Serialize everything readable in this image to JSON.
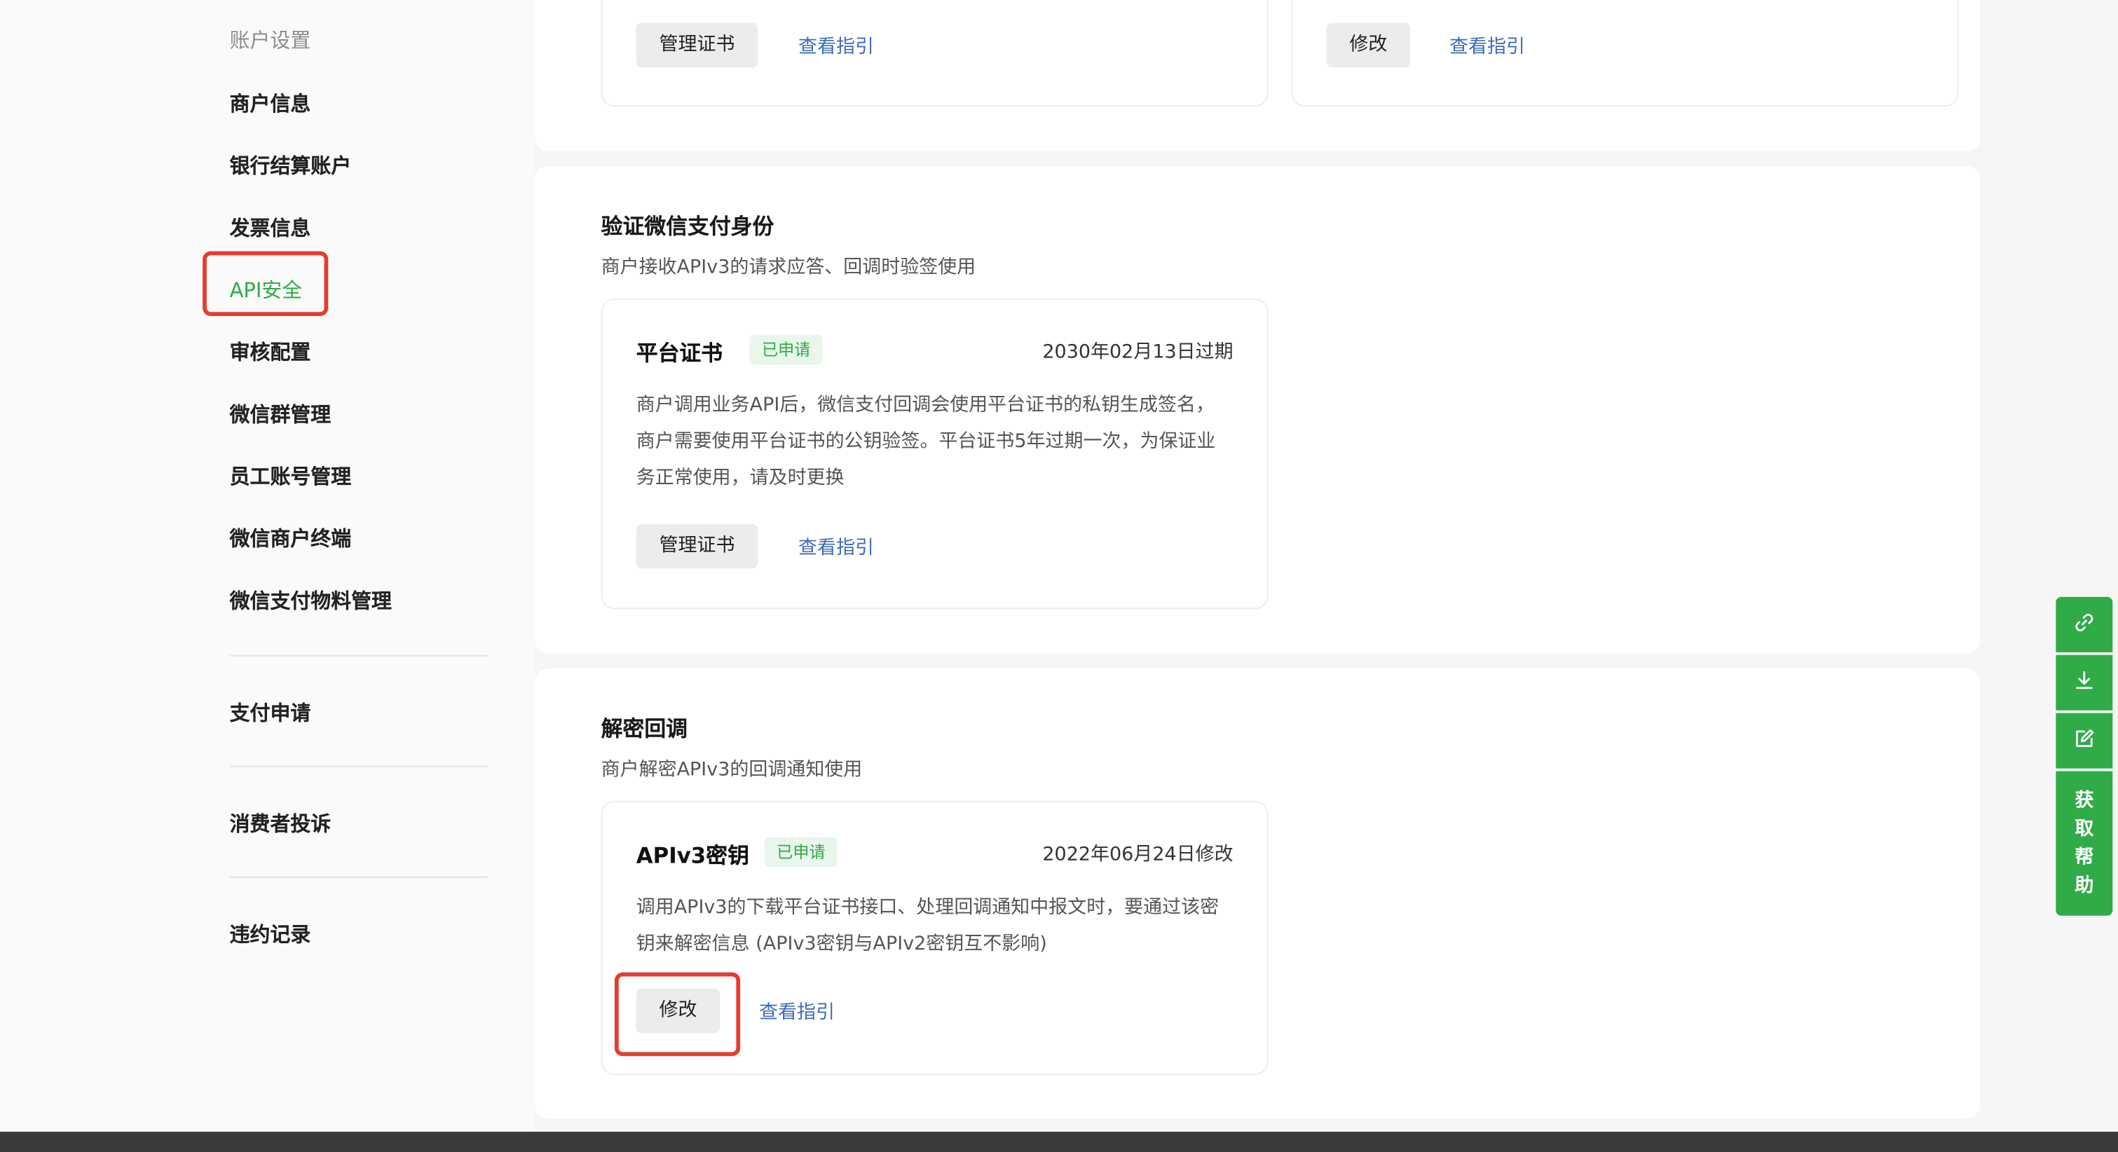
{
  "sidebar": {
    "group_title": "账户设置",
    "items": [
      {
        "label": "商户信息"
      },
      {
        "label": "银行结算账户"
      },
      {
        "label": "发票信息"
      },
      {
        "label": "API安全"
      },
      {
        "label": "审核配置"
      },
      {
        "label": "微信群管理"
      },
      {
        "label": "员工账号管理"
      },
      {
        "label": "微信商户终端"
      },
      {
        "label": "微信支付物料管理"
      }
    ],
    "active_item": "API安全",
    "sections": [
      {
        "label": "支付申请"
      },
      {
        "label": "消费者投诉"
      },
      {
        "label": "违约记录"
      }
    ]
  },
  "top_panel": {
    "left_card": {
      "button": "管理证书",
      "link": "查看指引"
    },
    "right_card": {
      "button": "修改",
      "link": "查看指引"
    }
  },
  "verify_panel": {
    "title": "验证微信支付身份",
    "description": "商户接收APIv3的请求应答、回调时验签使用",
    "card": {
      "title": "平台证书",
      "badge": "已申请",
      "date": "2030年02月13日过期",
      "body": "商户调用业务API后，微信支付回调会使用平台证书的私钥生成签名，商户需要使用平台证书的公钥验签。平台证书5年过期一次，为保证业务正常使用，请及时更换",
      "button": "管理证书",
      "link": "查看指引"
    }
  },
  "decrypt_panel": {
    "title": "解密回调",
    "description": "商户解密APIv3的回调通知使用",
    "card": {
      "title": "APIv3密钥",
      "badge": "已申请",
      "date": "2022年06月24日修改",
      "body": "调用APIv3的下载平台证书接口、处理回调通知中报文时，要通过该密钥来解密信息 (APIv3密钥与APIv2密钥互不影响)",
      "button": "修改",
      "link": "查看指引"
    }
  },
  "float_toolbar": {
    "icons": [
      "link-icon",
      "download-icon",
      "edit-icon"
    ],
    "help_label": "获取帮助"
  },
  "colors": {
    "accent": "#2fab47",
    "link": "#3c6cb6",
    "highlight": "#e63b2e",
    "background": "#f6f6f6"
  }
}
